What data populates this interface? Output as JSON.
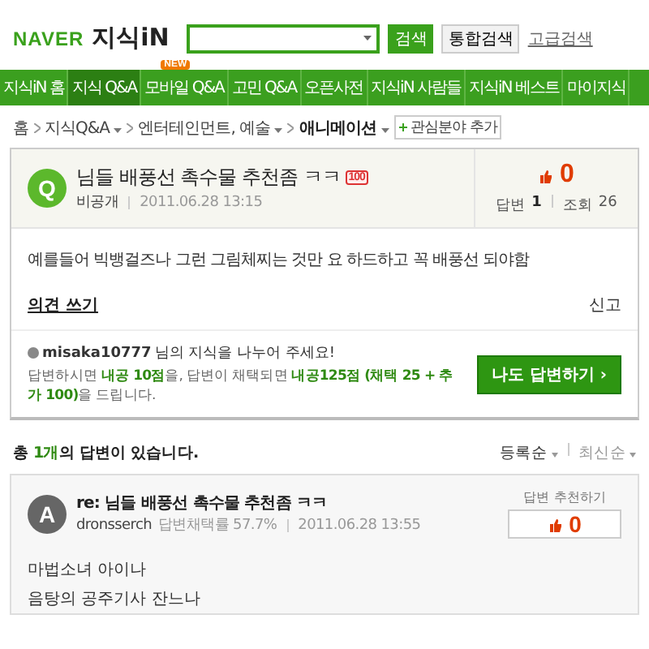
{
  "header": {
    "logo": "NAVER",
    "service": "지식iN",
    "search_button": "검색",
    "integrated_button": "통합검색",
    "advanced_link": "고급검색"
  },
  "nav": [
    {
      "label": "지식iN 홈",
      "selected": false
    },
    {
      "label": "지식 Q&A",
      "selected": true
    },
    {
      "label": "모바일 Q&A",
      "selected": false,
      "badge": "NEW"
    },
    {
      "label": "고민 Q&A",
      "selected": false
    },
    {
      "label": "오픈사전",
      "selected": false
    },
    {
      "label": "지식iN 사람들",
      "selected": false
    },
    {
      "label": "지식iN 베스트",
      "selected": false
    },
    {
      "label": "마이지식",
      "selected": false
    }
  ],
  "breadcrumb": {
    "items": [
      {
        "label": "홈",
        "dropdown": false,
        "current": false
      },
      {
        "label": "지식Q&A",
        "dropdown": true,
        "current": false
      },
      {
        "label": "엔터테인먼트, 예술",
        "dropdown": true,
        "current": false
      },
      {
        "label": "애니메이션",
        "dropdown": true,
        "current": true
      }
    ],
    "add_button": "관심분야 추가"
  },
  "question": {
    "letter": "Q",
    "title": "님들 배풍선 촉수물 추천좀 ㅋㅋ",
    "points": "100",
    "author": "비공개",
    "date": "2011.06.28 13:15",
    "likes": "0",
    "answers_label": "답변",
    "answers": "1",
    "views_label": "조회",
    "views": "26",
    "body": "예를들어 빅뱅걸즈나 그런 그림체찌는 것만 요 하드하고 꼭 배풍선 되야함",
    "comment_link": "의견 쓰기",
    "report": "신고"
  },
  "invite": {
    "user": "misaka10777",
    "text": "님의 지식을 나누어 주세요!",
    "reward": "답변하시면 **내공 10점**을, 답변이 채택되면 **내공125점 (채택 25 + 추가 100)**을 드립니다.",
    "button": "나도 답변하기 ›"
  },
  "answers_bar": {
    "summary": "총 **1개**의 답변이 있습니다.",
    "sorts": [
      {
        "label": "등록순",
        "selected": true
      },
      {
        "label": "최신순",
        "selected": false
      }
    ]
  },
  "answer": {
    "letter": "A",
    "title": "re: 님들 배풍선 촉수물 추천좀 ㅋㅋ",
    "author": "dronsserch",
    "rate": "답변채택률 57.7%",
    "date": "2011.06.28 13:55",
    "recommend_label": "답변 추천하기",
    "likes": "0",
    "lines": [
      "마법소녀 아이나",
      "음탕의 공주기사 잔느나"
    ]
  }
}
